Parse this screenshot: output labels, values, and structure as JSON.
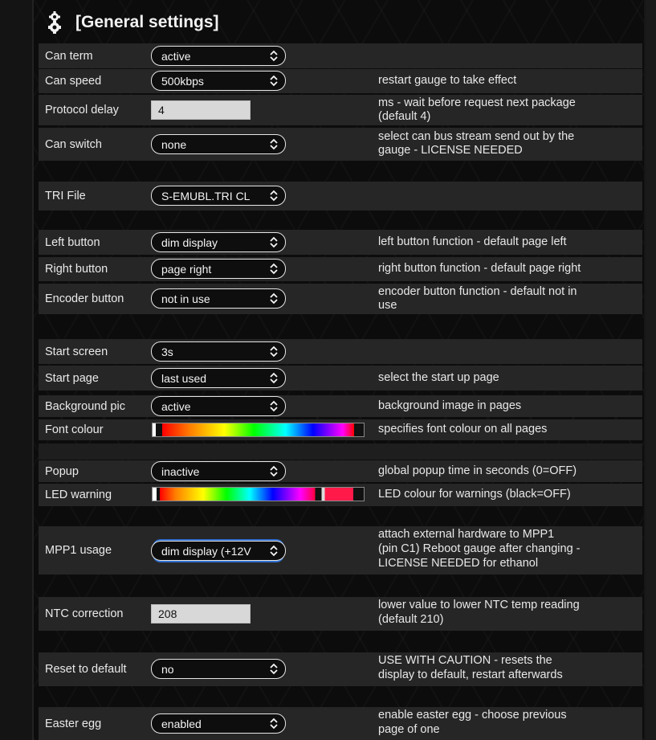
{
  "header": {
    "title": "[General settings]",
    "icon": "gears-icon"
  },
  "rows": {
    "can_term": {
      "label": "Can term",
      "value": "active"
    },
    "can_speed": {
      "label": "Can speed",
      "value": "500kbps",
      "desc": "restart gauge to take effect"
    },
    "protocol_delay": {
      "label": "Protocol delay",
      "value": "4",
      "desc1": "ms - wait before request next package",
      "desc2": "(default 4)"
    },
    "can_switch": {
      "label": "Can switch",
      "value": "none",
      "desc1": "select can bus stream send out by the",
      "desc2": "gauge - LICENSE NEEDED"
    },
    "tri_file": {
      "label": "TRI File",
      "value": "S-EMUBL.TRI CL"
    },
    "left_button": {
      "label": "Left button",
      "value": "dim display",
      "desc": "left button function - default page left"
    },
    "right_button": {
      "label": "Right button",
      "value": "page right",
      "desc": "right button function - default page right"
    },
    "encoder_button": {
      "label": "Encoder button",
      "value": "not in use",
      "desc1": "encoder button function - default not in",
      "desc2": "use"
    },
    "start_screen": {
      "label": "Start screen",
      "value": "3s"
    },
    "start_page": {
      "label": "Start page",
      "value": "last used",
      "desc": "select the start up page"
    },
    "background_pic": {
      "label": "Background pic",
      "value": "active",
      "desc": "background image in pages"
    },
    "font_colour": {
      "label": "Font colour",
      "desc": "specifies font colour on all pages"
    },
    "popup": {
      "label": "Popup",
      "value": "inactive",
      "desc": "global popup time in seconds (0=OFF)"
    },
    "led_warning": {
      "label": "LED warning",
      "desc": "LED colour for warnings (black=OFF)"
    },
    "mpp1_usage": {
      "label": "MPP1 usage",
      "value": "dim display (+12V",
      "desc1": "attach external hardware to MPP1",
      "desc2": "(pin C1) Reboot gauge after changing -",
      "desc3": "LICENSE NEEDED for ethanol"
    },
    "ntc_correction": {
      "label": "NTC correction",
      "value": "208",
      "desc1": "lower value to lower NTC temp reading",
      "desc2": "(default 210)"
    },
    "reset_default": {
      "label": "Reset to default",
      "value": "no",
      "desc1": "USE WITH CAUTION - resets the",
      "desc2": "display to default, restart afterwards"
    },
    "easter_egg": {
      "label": "Easter egg",
      "value": "enabled",
      "desc1": "enable easter egg - choose previous",
      "desc2": "page of one"
    }
  },
  "colors": {
    "row_bg": "#262626",
    "panel_bg": "#0c0c0c",
    "input_bg": "#d8d8d8",
    "accent_glow": "#2f6fd0"
  }
}
